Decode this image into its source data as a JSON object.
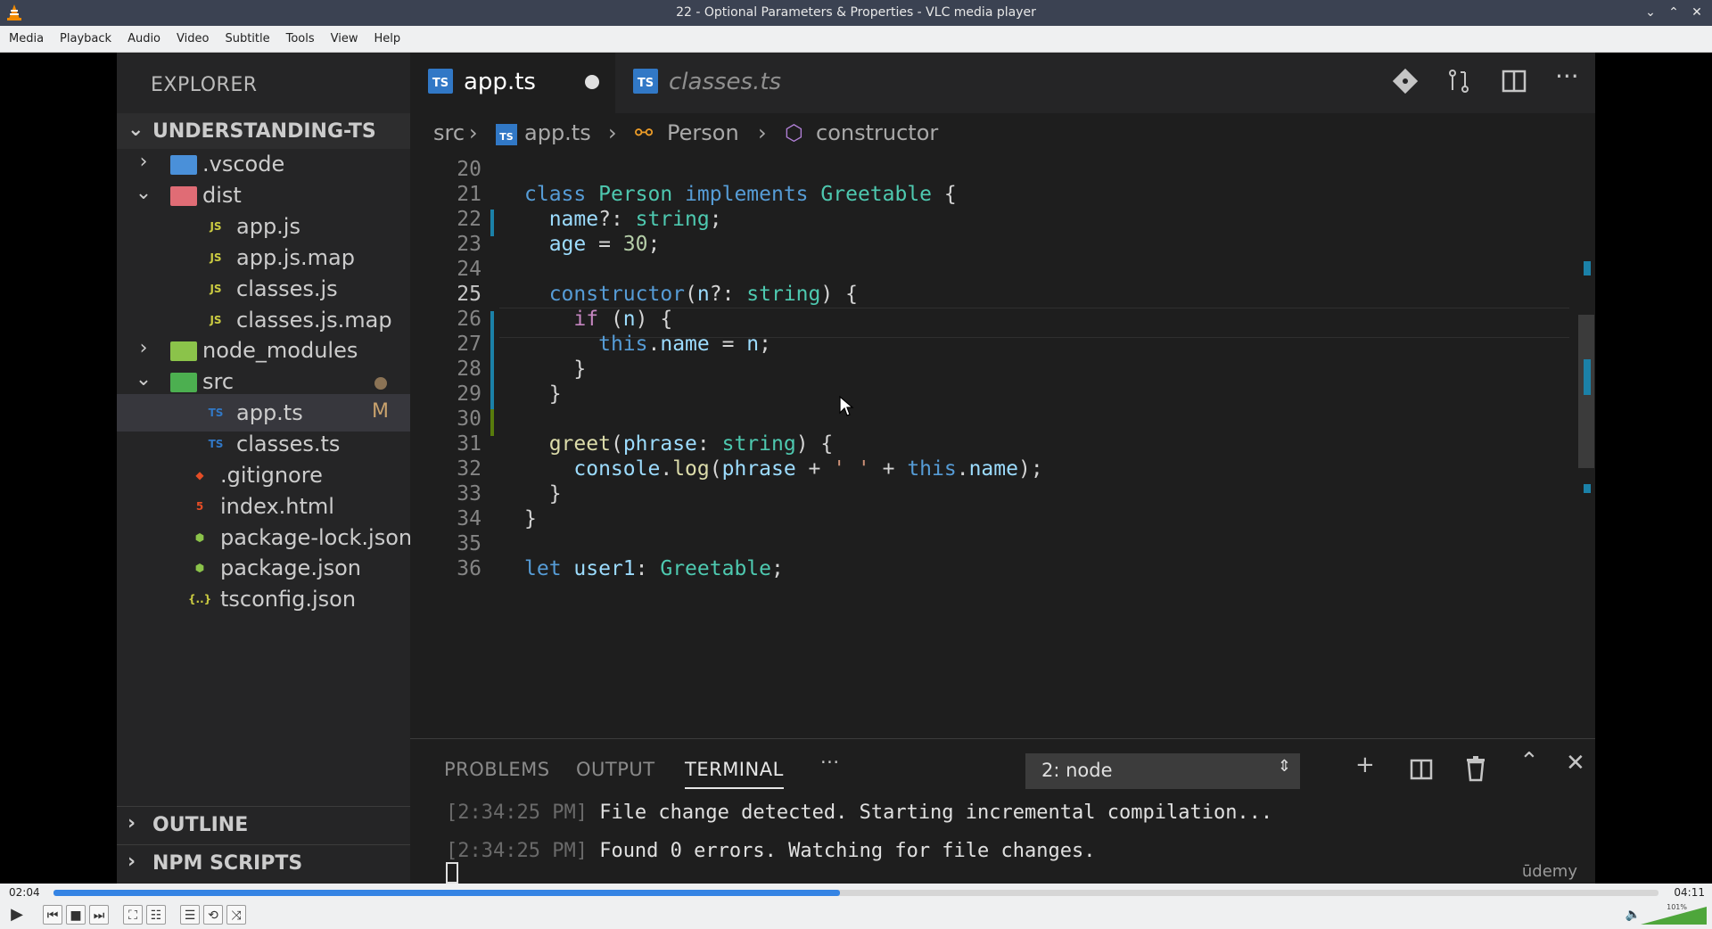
{
  "window": {
    "title": "22 - Optional Parameters & Properties - VLC media player",
    "controls": [
      "⌄",
      "⌃",
      "✕"
    ]
  },
  "menubar": [
    "Media",
    "Playback",
    "Audio",
    "Video",
    "Subtitle",
    "Tools",
    "View",
    "Help"
  ],
  "vscode": {
    "explorer_title": "EXPLORER",
    "project": "UNDERSTANDING-TS",
    "tree": [
      {
        "name": ".vscode",
        "type": "folder",
        "icon_text": "",
        "color": "#4a90d9"
      },
      {
        "name": "dist",
        "type": "folder-open",
        "icon_text": "",
        "color": "#e06c75"
      },
      {
        "name": "app.js",
        "type": "file",
        "icon_text": "JS",
        "color": "#cbcb41"
      },
      {
        "name": "app.js.map",
        "type": "file",
        "icon_text": "JS",
        "color": "#cbcb41"
      },
      {
        "name": "classes.js",
        "type": "file",
        "icon_text": "JS",
        "color": "#cbcb41"
      },
      {
        "name": "classes.js.map",
        "type": "file",
        "icon_text": "JS",
        "color": "#cbcb41"
      },
      {
        "name": "node_modules",
        "type": "folder",
        "icon_text": "",
        "color": "#8bc34a"
      },
      {
        "name": "src",
        "type": "folder-open",
        "icon_text": "",
        "color": "#4caf50"
      },
      {
        "name": "app.ts",
        "type": "file",
        "icon_text": "TS",
        "color": "#3178c6",
        "badge": "M"
      },
      {
        "name": "classes.ts",
        "type": "file",
        "icon_text": "TS",
        "color": "#3178c6"
      },
      {
        "name": ".gitignore",
        "type": "file",
        "icon_text": "◆",
        "color": "#e44d26"
      },
      {
        "name": "index.html",
        "type": "file",
        "icon_text": "5",
        "color": "#e44d26"
      },
      {
        "name": "package-lock.json",
        "type": "file",
        "icon_text": "⬢",
        "color": "#8bc34a"
      },
      {
        "name": "package.json",
        "type": "file",
        "icon_text": "⬢",
        "color": "#8bc34a"
      },
      {
        "name": "tsconfig.json",
        "type": "file",
        "icon_text": "{..}",
        "color": "#cbcb41"
      }
    ],
    "outline": "OUTLINE",
    "npm_scripts": "NPM SCRIPTS",
    "tabs": [
      {
        "label": "app.ts",
        "active": true,
        "modified": true
      },
      {
        "label": "classes.ts",
        "active": false,
        "modified": false
      }
    ],
    "breadcrumbs": [
      "src",
      "app.ts",
      "Person",
      "constructor"
    ],
    "line_numbers": [
      "20",
      "21",
      "22",
      "23",
      "24",
      "25",
      "26",
      "27",
      "28",
      "29",
      "30",
      "31",
      "32",
      "33",
      "34",
      "35",
      "36"
    ],
    "current_line": "25",
    "panel": {
      "tabs": [
        "PROBLEMS",
        "OUTPUT",
        "TERMINAL"
      ],
      "active_tab": "TERMINAL",
      "more": "···",
      "terminal_select": "2: node",
      "lines": [
        {
          "time": "[2:34:25 PM]",
          "text": " File change detected. Starting incremental compilation..."
        },
        {
          "time": "[2:34:25 PM]",
          "text": " Found 0 errors. Watching for file changes."
        }
      ],
      "watermark": "ūdemy"
    }
  },
  "player": {
    "elapsed": "02:04",
    "total": "04:11",
    "progress_fraction": 0.49,
    "volume": "101%"
  }
}
